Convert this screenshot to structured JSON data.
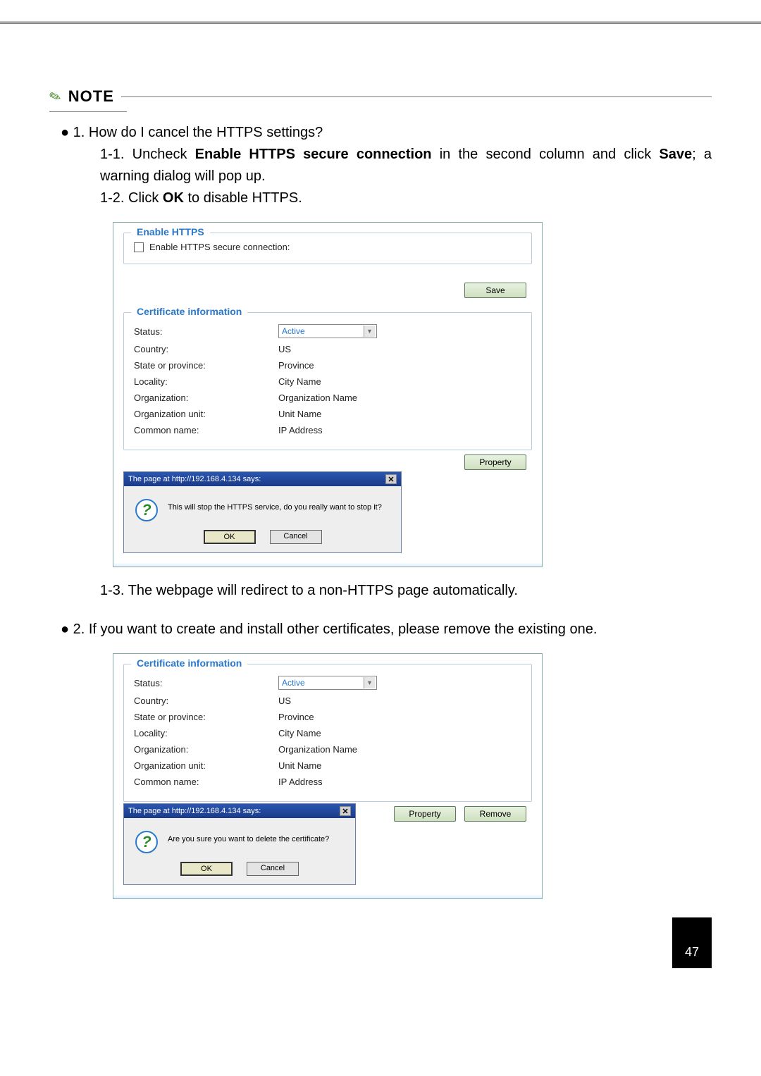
{
  "note_label": "NOTE",
  "q1_intro": "● 1. How do I cancel the HTTPS settings?",
  "q1_1_prefix": "1-1. Uncheck ",
  "q1_1_bold1": "Enable HTTPS secure connection",
  "q1_1_mid": " in the second column and click ",
  "q1_1_bold2": "Save",
  "q1_1_suffix": "; a warning dialog will pop up.",
  "q1_2_prefix": "1-2. Click ",
  "q1_2_bold": "OK",
  "q1_2_suffix": " to disable HTTPS.",
  "q1_3": "1-3. The webpage will redirect to a non-HTTPS page automatically.",
  "q2": "● 2. If you want to create and install other certificates, please remove the existing one.",
  "shot1": {
    "legend_enable": "Enable HTTPS",
    "chk_label": "Enable HTTPS secure connection:",
    "save_btn": "Save",
    "legend_cert": "Certificate information",
    "rows": {
      "status": "Status:",
      "status_val": "Active",
      "country": "Country:",
      "country_val": "US",
      "state": "State or province:",
      "state_val": "Province",
      "locality": "Locality:",
      "locality_val": "City Name",
      "org": "Organization:",
      "org_val": "Organization Name",
      "org_unit": "Organization unit:",
      "org_unit_val": "Unit Name",
      "common": "Common name:",
      "common_val": "IP Address"
    },
    "property_btn": "Property",
    "dlg_title": "The page at http://192.168.4.134 says:",
    "dlg_msg": "This will stop the HTTPS service, do you really want to stop it?",
    "ok": "OK",
    "cancel": "Cancel"
  },
  "shot2": {
    "legend_cert": "Certificate information",
    "rows": {
      "status": "Status:",
      "status_val": "Active",
      "country": "Country:",
      "country_val": "US",
      "state": "State or province:",
      "state_val": "Province",
      "locality": "Locality:",
      "locality_val": "City Name",
      "org": "Organization:",
      "org_val": "Organization Name",
      "org_unit": "Organization unit:",
      "org_unit_val": "Unit Name",
      "common": "Common name:",
      "common_val": "IP Address"
    },
    "property_btn": "Property",
    "remove_btn": "Remove",
    "dlg_title": "The page at http://192.168.4.134 says:",
    "dlg_msg": "Are you sure you want to delete the certificate?",
    "ok": "OK",
    "cancel": "Cancel"
  },
  "page_number": "47"
}
